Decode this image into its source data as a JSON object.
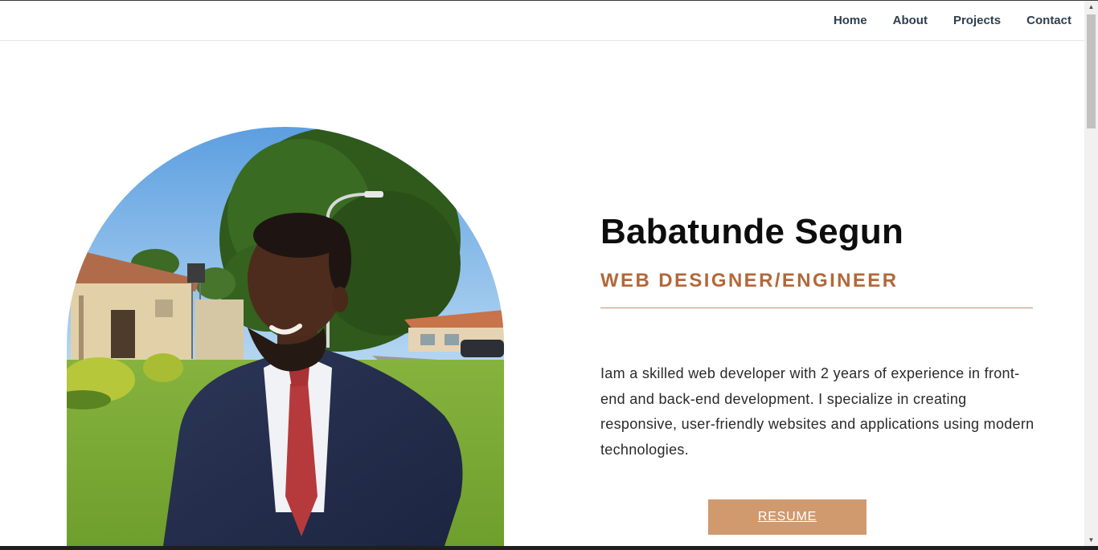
{
  "nav": {
    "items": [
      {
        "label": "Home"
      },
      {
        "label": "About"
      },
      {
        "label": "Projects"
      },
      {
        "label": "Contact"
      }
    ]
  },
  "hero": {
    "name": "Babatunde Segun",
    "role": "WEB DESIGNER/ENGINEER",
    "bio": "Iam a skilled web developer with 2 years of experience in front-end and back-end development. I specialize in creating responsive, user-friendly websites and applications using modern technologies.",
    "resume_label": "RESUME",
    "photo_icon": "profile-photo"
  },
  "colors": {
    "accent": "#b2683a",
    "button": "#d09a6e",
    "nav_text": "#2f3e4e",
    "heading": "#0d0d0d"
  }
}
